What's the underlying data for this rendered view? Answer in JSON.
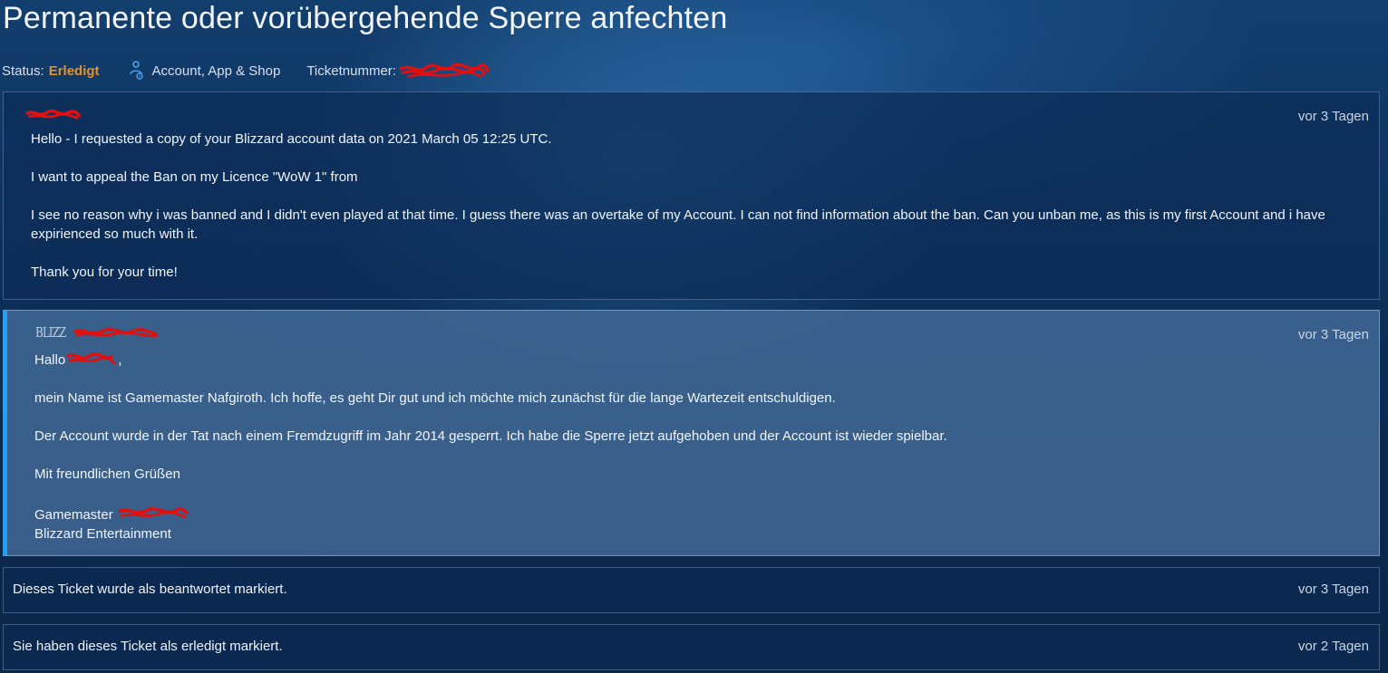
{
  "page_title": "Permanente oder vorübergehende Sperre anfechten",
  "meta": {
    "status_label": "Status:",
    "status_value": "Erledigt",
    "category": "Account, App & Shop",
    "ticket_label": "Ticketnummer:",
    "status_color": "#e0922e"
  },
  "messages": [
    {
      "time": "vor 3 Tagen",
      "paragraphs": [
        "Hello - I requested a copy of your Blizzard account data on  2021 March 05 12:25 UTC.",
        "I want to appeal the Ban on my Licence \"WoW 1\" from",
        "I see no reason why i was banned and I didn't even played at that time. I guess there was an overtake of my Account. I can not find information about the ban. Can you unban me, as this is my first Account and i have expirienced so much with it.",
        "Thank you for your time!"
      ]
    },
    {
      "time": "vor 3 Tagen",
      "logo_text": "BLIZZ",
      "greeting": "Hallo",
      "greeting_end": ",",
      "paragraphs": [
        "mein Name ist Gamemaster Nafgiroth. Ich hoffe, es geht Dir gut und ich möchte mich zunächst für die lange Wartezeit entschuldigen.",
        "Der Account wurde in der Tat nach einem Fremdzugriff im Jahr 2014 gesperrt. Ich habe die Sperre jetzt aufgehoben und der Account ist wieder spielbar.",
        "Mit freundlichen Grüßen"
      ],
      "signature_title": "Gamemaster",
      "signature_company": "Blizzard Entertainment"
    }
  ],
  "events": [
    {
      "text": "Dieses Ticket wurde als beantwortet markiert.",
      "time": "vor 3 Tagen"
    },
    {
      "text": "Sie haben dieses Ticket als erledigt markiert.",
      "time": "vor 2 Tagen"
    }
  ],
  "icons": {
    "category": "person-gear-icon",
    "logo": "blizzard-staff-logo"
  },
  "colors": {
    "accent": "#1aa3ff",
    "redaction": "#e01010"
  }
}
